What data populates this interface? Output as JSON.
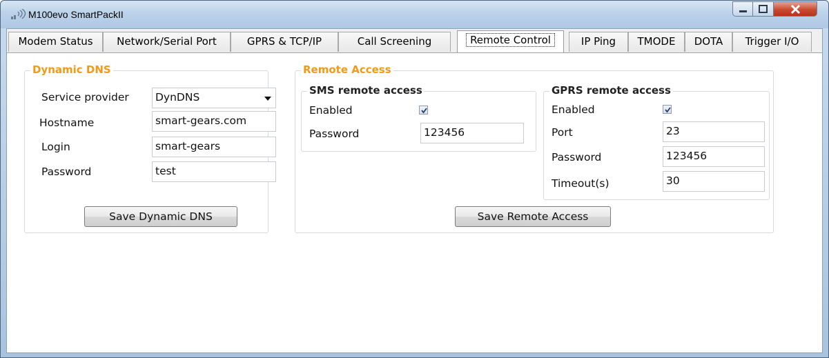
{
  "window": {
    "title": "M100evo SmartPackII",
    "controls": {
      "minimize_icon": "minimize-icon",
      "maximize_icon": "maximize-icon",
      "close_icon": "close-icon"
    }
  },
  "tabs": [
    {
      "label": "Modem Status",
      "active": false
    },
    {
      "label": "Network/Serial Port",
      "active": false
    },
    {
      "label": "GPRS & TCP/IP",
      "active": false
    },
    {
      "label": "Call Screening",
      "active": false
    },
    {
      "label": "Remote Control",
      "active": true
    },
    {
      "label": "IP Ping",
      "active": false
    },
    {
      "label": "TMODE",
      "active": false
    },
    {
      "label": "DOTA",
      "active": false
    },
    {
      "label": "Trigger I/O",
      "active": false
    }
  ],
  "dynamic_dns": {
    "legend": "Dynamic DNS",
    "service_provider_label": "Service provider",
    "service_provider_value": "DynDNS",
    "hostname_label": "Hostname",
    "hostname_value": "smart-gears.com",
    "login_label": "Login",
    "login_value": "smart-gears",
    "password_label": "Password",
    "password_value": "test",
    "save_label": "Save Dynamic DNS"
  },
  "remote_access": {
    "legend": "Remote Access",
    "sms": {
      "legend": "SMS remote access",
      "enabled_label": "Enabled",
      "enabled": true,
      "password_label": "Password",
      "password_value": "123456"
    },
    "gprs": {
      "legend": "GPRS remote access",
      "enabled_label": "Enabled",
      "enabled": true,
      "port_label": "Port",
      "port_value": "23",
      "password_label": "Password",
      "password_value": "123456",
      "timeout_label": "Timeout(s)",
      "timeout_value": "30"
    },
    "save_label": "Save Remote Access"
  },
  "colors": {
    "legend_accent": "#f29a17",
    "title_bar": "#bcd2ea",
    "close_button": "#c94b2f"
  }
}
